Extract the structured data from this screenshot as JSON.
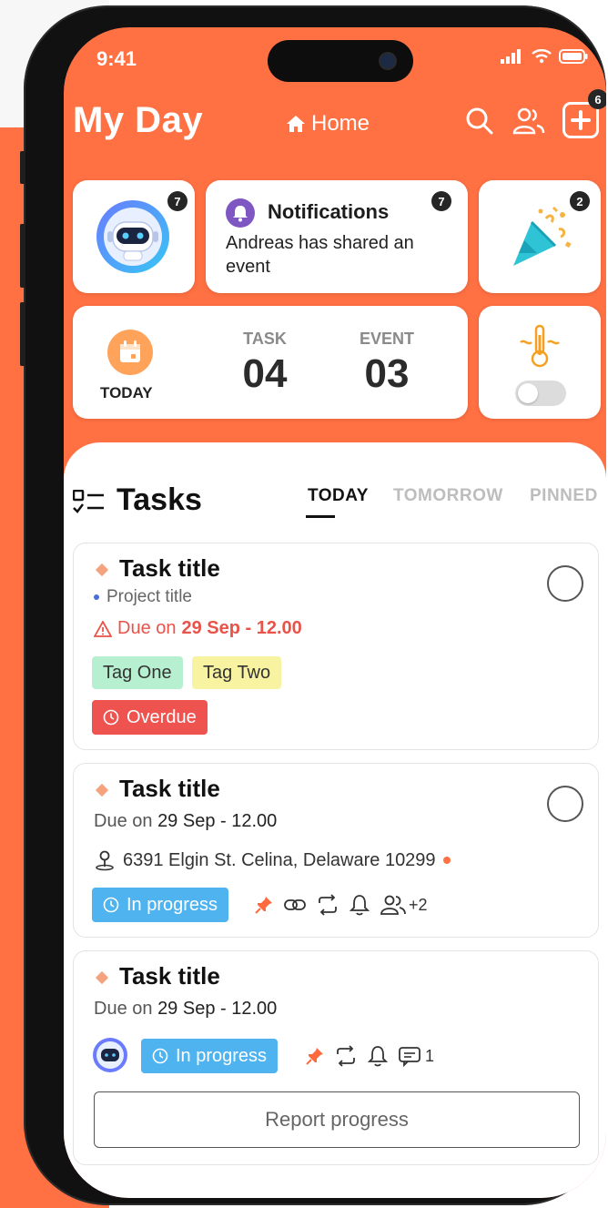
{
  "status_bar": {
    "time": "9:41"
  },
  "header": {
    "title": "My Day",
    "home_label": "Home",
    "add_badge": "6"
  },
  "cards": {
    "bot_badge": "7",
    "notifications": {
      "title": "Notifications",
      "body": "Andreas has shared an event",
      "badge": "7"
    },
    "party_badge": "2",
    "today": {
      "label": "TODAY",
      "task_label": "TASK",
      "task_value": "04",
      "event_label": "EVENT",
      "event_value": "03"
    }
  },
  "tasks_section": {
    "title": "Tasks",
    "tabs": [
      {
        "label": "TODAY",
        "active": true
      },
      {
        "label": "TOMORROW",
        "active": false
      },
      {
        "label": "PINNED",
        "active": false
      }
    ]
  },
  "tasks": [
    {
      "title": "Task title",
      "project": "Project title",
      "due_prefix": "Due on",
      "due_value": "29 Sep - 12.00",
      "tags": [
        "Tag One",
        "Tag Two"
      ],
      "status": "Overdue"
    },
    {
      "title": "Task title",
      "due_prefix": "Due on",
      "due_value": "29 Sep - 12.00",
      "address": "6391 Elgin St. Celina, Delaware 10299",
      "status": "In progress",
      "assignees_extra": "+2"
    },
    {
      "title": "Task title",
      "due_prefix": "Due on",
      "due_value": "29 Sep - 12.00",
      "status": "In progress",
      "comments_count": "1",
      "report_label": "Report progress"
    }
  ],
  "colors": {
    "brand": "#ff7043",
    "overdue": "#ef5350",
    "in_progress": "#4fb3f0",
    "tag_one": "#b7f0d0",
    "tag_two": "#f7f3a0"
  }
}
